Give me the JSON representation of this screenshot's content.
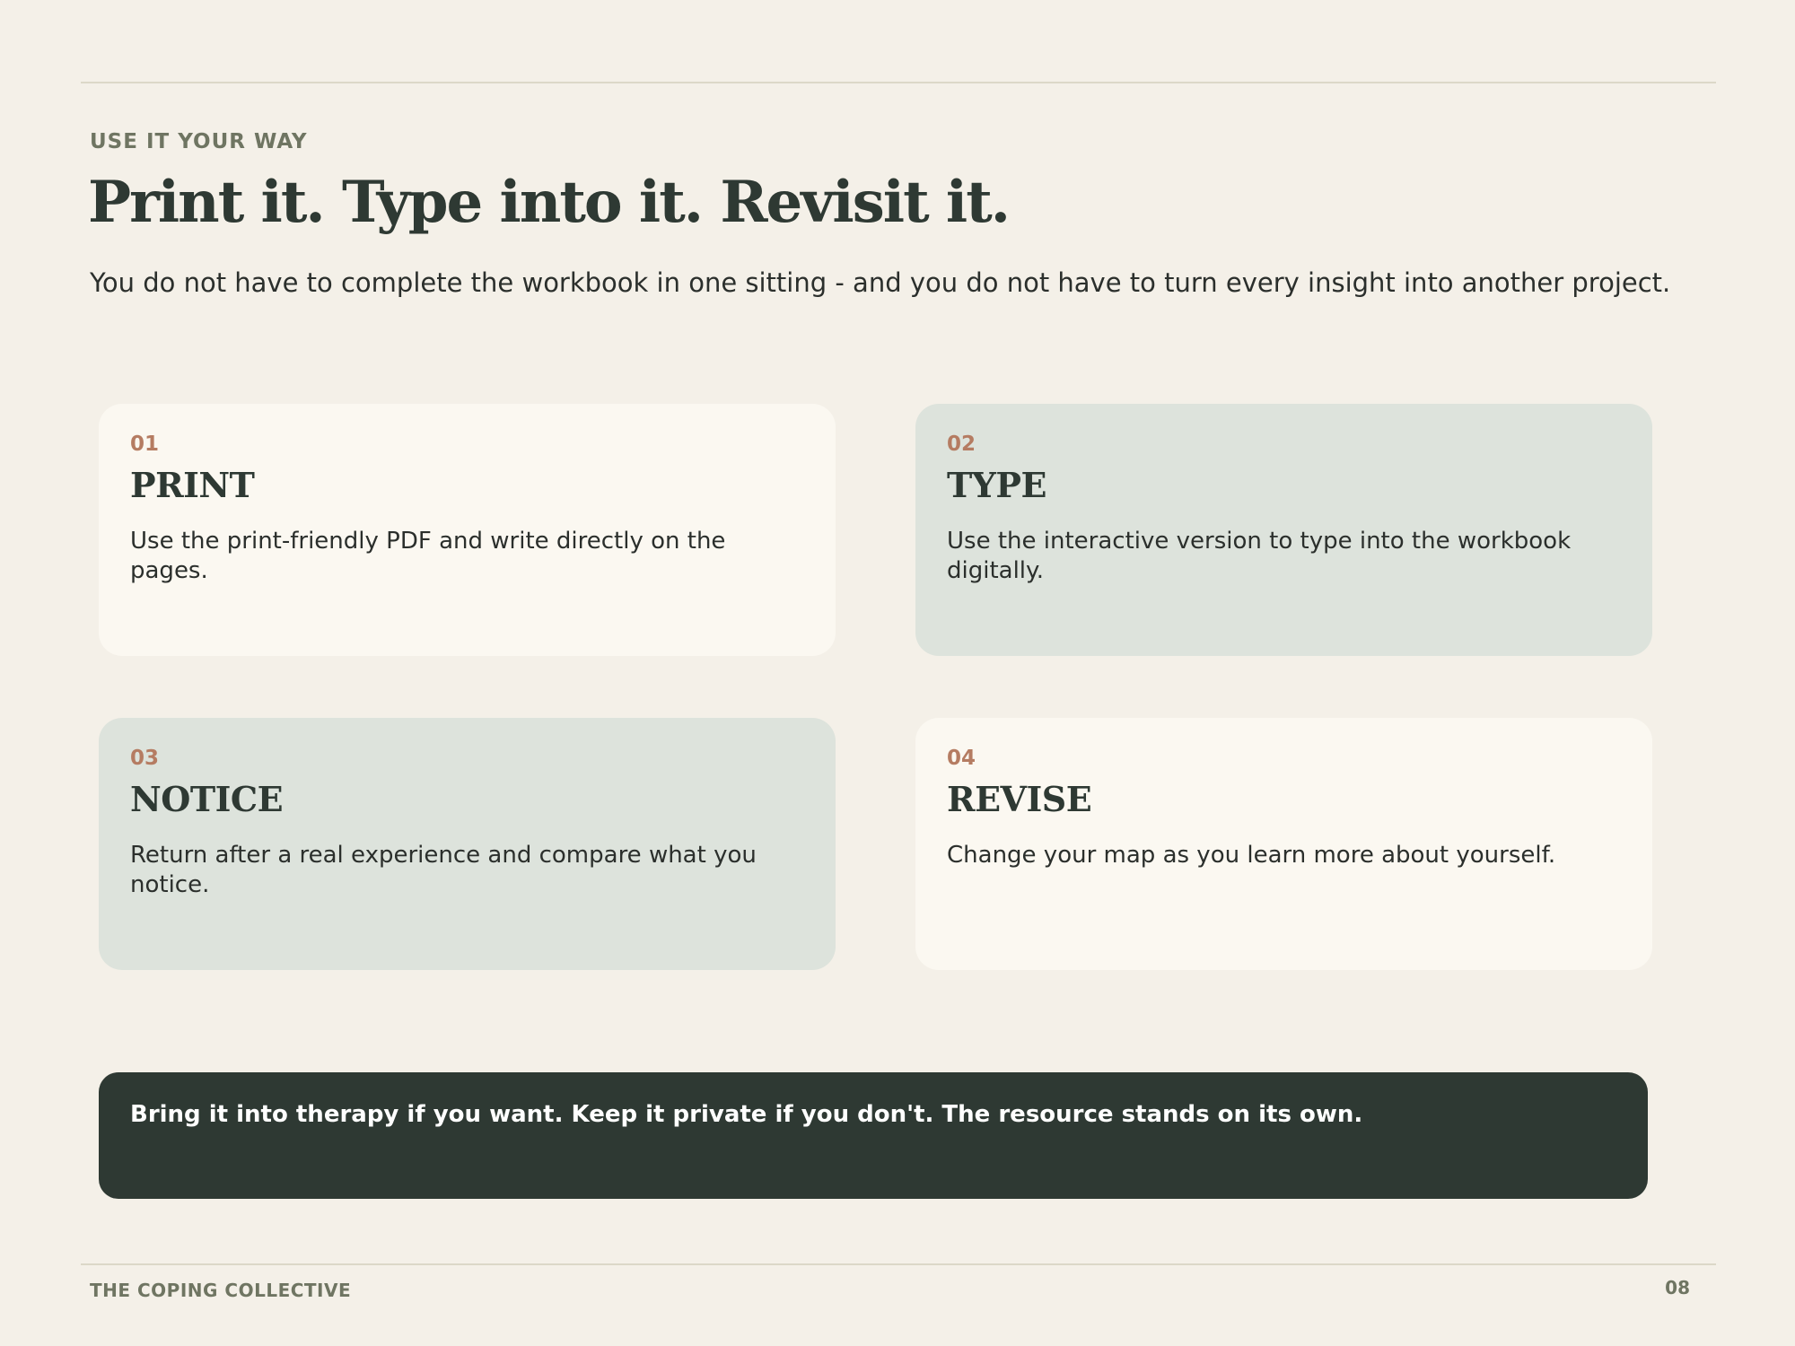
{
  "header": {
    "eyebrow": "USE IT YOUR WAY",
    "title": "Print it. Type into it. Revisit it.",
    "subtitle": "You do not have to complete the workbook in one sitting - and you do not have to turn every insight into another project."
  },
  "cards": [
    {
      "number": "01",
      "heading": "PRINT",
      "body": "Use the print-friendly PDF and write directly on the pages."
    },
    {
      "number": "02",
      "heading": "TYPE",
      "body": "Use the interactive version to type into the workbook digitally."
    },
    {
      "number": "03",
      "heading": "NOTICE",
      "body": "Return after a real experience and compare what you notice."
    },
    {
      "number": "04",
      "heading": "REVISE",
      "body": "Change your map as you learn more about yourself."
    }
  ],
  "callout": {
    "text": "Bring it into therapy if you want. Keep it private if you don't. The resource stands on its own."
  },
  "footer": {
    "brand": "THE COPING COLLECTIVE",
    "page_number": "08"
  },
  "colors": {
    "background": "#f4f0e8",
    "card_light": "#fbf8f1",
    "card_sage": "#dde3dc",
    "accent_number": "#b57c62",
    "dark_green": "#2e3933",
    "muted_label": "#6f7562"
  }
}
